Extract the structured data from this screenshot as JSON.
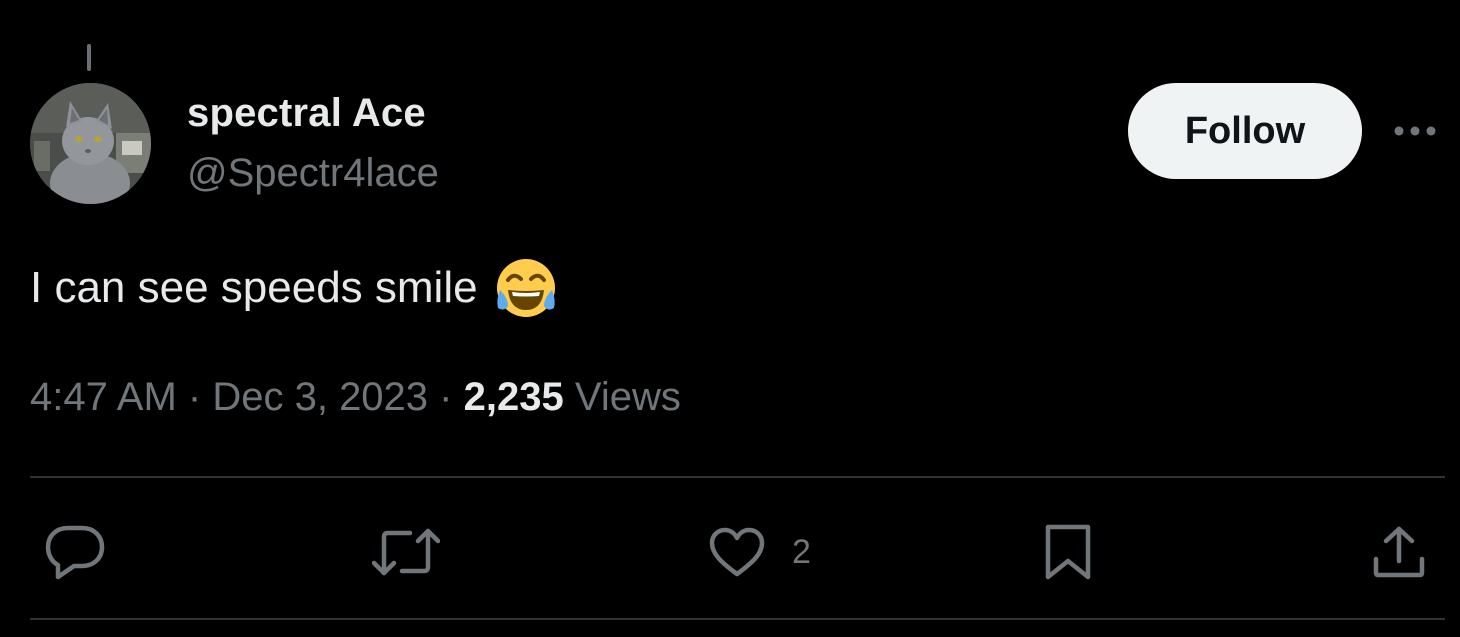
{
  "tweet": {
    "author": {
      "display_name": "spectral Ace",
      "handle": "@Spectr4lace",
      "avatar": "cat-avatar"
    },
    "follow_label": "Follow",
    "more_icon": "more-horizontal-icon",
    "text": "I can see speeds smile",
    "emoji": "😂",
    "meta": {
      "time": "4:47 AM",
      "separator": "·",
      "date": "Dec 3, 2023",
      "views_count": "2,235",
      "views_label": "Views"
    },
    "actions": {
      "reply_icon": "reply-icon",
      "retweet_icon": "retweet-icon",
      "like_icon": "heart-icon",
      "like_count": "2",
      "bookmark_icon": "bookmark-icon",
      "share_icon": "share-icon"
    }
  },
  "colors": {
    "background": "#000000",
    "primary_text": "#e7e9ea",
    "secondary_text": "#71767b",
    "divider": "#2f3336",
    "follow_button_bg": "#eff3f4",
    "follow_button_text": "#0f1419"
  }
}
